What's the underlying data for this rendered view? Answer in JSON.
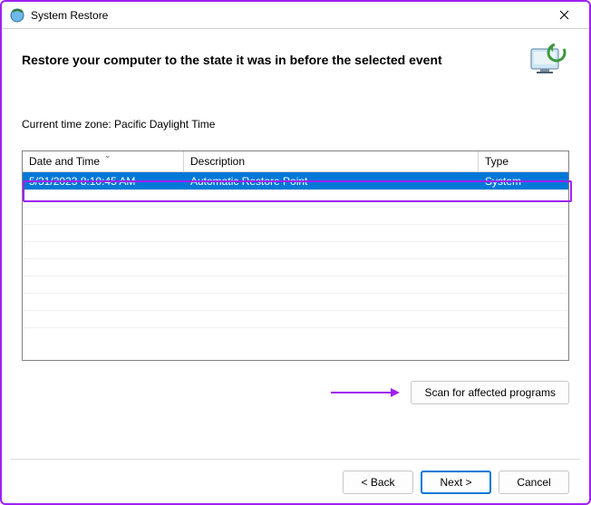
{
  "window": {
    "title": "System Restore"
  },
  "header": {
    "text": "Restore your computer to the state it was in before the selected event"
  },
  "timezone_label": "Current time zone: Pacific Daylight Time",
  "table": {
    "columns": {
      "datetime": "Date and Time",
      "description": "Description",
      "type": "Type"
    },
    "rows": [
      {
        "datetime": "5/31/2023 8:10:45 AM",
        "description": "Automatic Restore Point",
        "type": "System"
      }
    ]
  },
  "buttons": {
    "scan": "Scan for affected programs",
    "back": "< Back",
    "next": "Next >",
    "cancel": "Cancel"
  }
}
